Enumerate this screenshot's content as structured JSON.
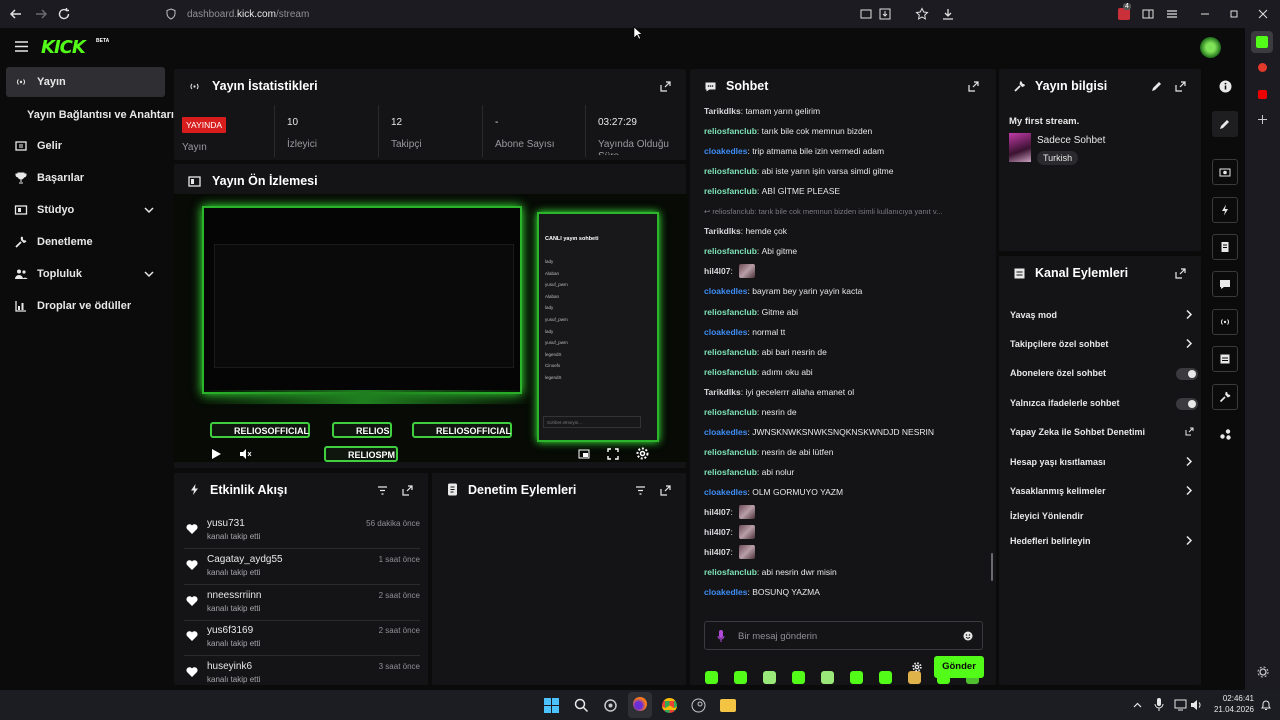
{
  "browser": {
    "url_prefix": "dashboard.",
    "url_domain": "kick.com",
    "url_path": "/stream",
    "extension_badge": "4"
  },
  "header": {
    "logo": "KICK",
    "beta": "BETA"
  },
  "sidebar": {
    "items": [
      {
        "label": "Yayın",
        "icon": "broadcast-icon",
        "active": true
      },
      {
        "label": "Yayın Bağlantısı ve Anahtarı",
        "icon": "",
        "active": false
      },
      {
        "label": "Gelir",
        "icon": "dollar-icon",
        "active": false
      },
      {
        "label": "Başarılar",
        "icon": "trophy-icon",
        "active": false
      },
      {
        "label": "Stüdyo",
        "icon": "studio-icon",
        "active": false,
        "expandable": true
      },
      {
        "label": "Denetleme",
        "icon": "wrench-icon",
        "active": false
      },
      {
        "label": "Topluluk",
        "icon": "people-icon",
        "active": false,
        "expandable": true
      },
      {
        "label": "Droplar ve ödüller",
        "icon": "gift-icon",
        "active": false
      }
    ]
  },
  "stats": {
    "title": "Yayın İstatistikleri",
    "live_badge": "YAYINDA",
    "cells": [
      {
        "value": "",
        "label": "Yayın"
      },
      {
        "value": "10",
        "label": "İzleyici"
      },
      {
        "value": "12",
        "label": "Takipçi"
      },
      {
        "value": "-",
        "label": "Abone Sayısı"
      },
      {
        "value": "03:27:29",
        "label": "Yayında Olduğu Süre"
      }
    ]
  },
  "preview": {
    "title": "Yayın Ön İzlemesi",
    "overlay_tags": [
      "RELIOSOFFICIAL",
      "RELIOS",
      "RELIOSOFFICIAL",
      "RELIOSPM"
    ],
    "inner_chat_title": "CANLI yayın sohbeti",
    "inner_chat_users": [
      "lady",
      "Alaban",
      "yusuf_pwm",
      "Alaban",
      "lady",
      "yusuf_pwm",
      "lady",
      "yusuf_pwm",
      "legendX",
      "Cinoefx",
      "legendX"
    ],
    "inner_chat_placeholder": "Sohbet etmeyin..."
  },
  "activity": {
    "title": "Etkinlik Akışı",
    "items": [
      {
        "user": "yusu731",
        "action": "kanalı takip etti",
        "time": "56 dakika önce"
      },
      {
        "user": "Cagatay_aydg55",
        "action": "kanalı takip etti",
        "time": "1 saat önce"
      },
      {
        "user": "nneessrriinn",
        "action": "kanalı takip etti",
        "time": "2 saat önce"
      },
      {
        "user": "yus6f3169",
        "action": "kanalı takip etti",
        "time": "2 saat önce"
      },
      {
        "user": "huseyink6",
        "action": "kanalı takip etti",
        "time": "3 saat önce"
      }
    ]
  },
  "moderation": {
    "title": "Denetim Eylemleri"
  },
  "chat": {
    "title": "Sohbet",
    "messages": [
      {
        "user": "Tarikdlks",
        "color": "#d8d8dc",
        "text": "tamam yarın gelirim"
      },
      {
        "user": "reliosfanclub",
        "color": "#7fe3b8",
        "text": "tarık bile cok memnun bizden"
      },
      {
        "user": "cloakedles",
        "color": "#3d8df5",
        "text": "trip atmama bile izin vermedi adam"
      },
      {
        "user": "reliosfanclub",
        "color": "#7fe3b8",
        "text": "abi iste yarın işin varsa simdi gitme"
      },
      {
        "user": "reliosfanclub",
        "color": "#7fe3b8",
        "text": "ABİ GİTME PLEASE"
      },
      {
        "reply": "reliosfanclub: tarık bile cok memnun bizden isimli kullanıcıya yanıt v..."
      },
      {
        "user": "Tarikdlks",
        "color": "#d8d8dc",
        "text": "hemde çok"
      },
      {
        "user": "reliosfanclub",
        "color": "#7fe3b8",
        "text": "Abi gitme"
      },
      {
        "user": "hil4l07",
        "color": "#d8d8dc",
        "text": "",
        "emote": true
      },
      {
        "user": "cloakedles",
        "color": "#3d8df5",
        "text": "bayram bey yarin yayin kacta"
      },
      {
        "user": "reliosfanclub",
        "color": "#7fe3b8",
        "text": "Gitme abi"
      },
      {
        "user": "cloakedles",
        "color": "#3d8df5",
        "text": "normal tt"
      },
      {
        "user": "reliosfanclub",
        "color": "#7fe3b8",
        "text": "abi bari nesrin de"
      },
      {
        "user": "reliosfanclub",
        "color": "#7fe3b8",
        "text": "adımı oku abi"
      },
      {
        "user": "Tarikdlks",
        "color": "#d8d8dc",
        "text": "iyi gecelerrr allaha emanet ol"
      },
      {
        "user": "reliosfanclub",
        "color": "#7fe3b8",
        "text": "nesrin de"
      },
      {
        "user": "cloakedles",
        "color": "#3d8df5",
        "text": "JWNSKNWKSNWKSNQKNSKWNDJD NESRIN"
      },
      {
        "user": "reliosfanclub",
        "color": "#7fe3b8",
        "text": "nesrin de abi lütfen"
      },
      {
        "user": "reliosfanclub",
        "color": "#7fe3b8",
        "text": "abi nolur"
      },
      {
        "user": "cloakedles",
        "color": "#3d8df5",
        "text": "OLM GORMUYO YAZM"
      },
      {
        "user": "hil4l07",
        "color": "#d8d8dc",
        "text": "",
        "emote": true
      },
      {
        "user": "hil4l07",
        "color": "#d8d8dc",
        "text": "",
        "emote": true
      },
      {
        "user": "hil4l07",
        "color": "#d8d8dc",
        "text": "",
        "emote": true
      },
      {
        "user": "reliosfanclub",
        "color": "#7fe3b8",
        "text": "abi nesrin dwr misin"
      },
      {
        "user": "cloakedles",
        "color": "#3d8df5",
        "text": "BOSUNQ YAZMA"
      }
    ],
    "input_placeholder": "Bir mesaj gönderin",
    "send_label": "Gönder"
  },
  "stream_info": {
    "title": "Yayın bilgisi",
    "stream_title": "My first stream.",
    "category": "Sadece Sohbet",
    "tag": "Turkish"
  },
  "channel_actions": {
    "title": "Kanal Eylemleri",
    "items": [
      {
        "label": "Yavaş mod",
        "control": "chevron"
      },
      {
        "label": "Takipçilere özel sohbet",
        "control": "chevron"
      },
      {
        "label": "Abonelere özel sohbet",
        "control": "toggle"
      },
      {
        "label": "Yalnızca ifadelerle sohbet",
        "control": "toggle"
      },
      {
        "label": "Yapay Zeka ile Sohbet Denetimi",
        "control": "external"
      },
      {
        "label": "Hesap yaşı kısıtlaması",
        "control": "chevron"
      },
      {
        "label": "Yasaklanmış kelimeler",
        "control": "chevron"
      },
      {
        "label": "İzleyici Yönlendir",
        "control": "none"
      },
      {
        "label": "Hedefleri belirleyin",
        "control": "chevron"
      }
    ]
  },
  "taskbar": {
    "time": "02:46:41",
    "date": "21.04.2026"
  },
  "colors": {
    "kick_green": "#53fc18",
    "live_red": "#d81d1d",
    "panel_bg": "#141416",
    "page_bg": "#0b0b0b"
  }
}
